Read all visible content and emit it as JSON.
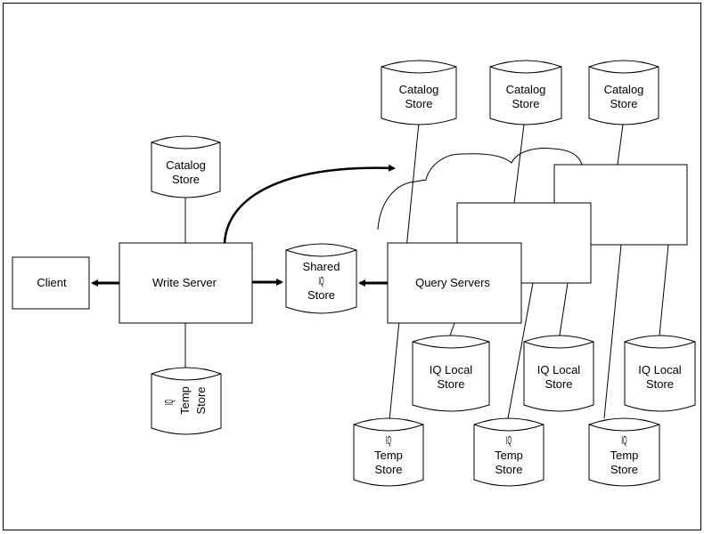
{
  "nodes": {
    "client": "Client",
    "write_server": "Write Server",
    "query_servers": "Query Servers",
    "write_catalog": [
      "Catalog",
      "Store"
    ],
    "write_temp": [
      "IQ",
      "Temp",
      "Store"
    ],
    "shared_store": [
      "Shared",
      "IQ",
      "Store"
    ],
    "query_catalogs": [
      [
        "Catalog",
        "Store"
      ],
      [
        "Catalog",
        "Store"
      ],
      [
        "Catalog",
        "Store"
      ]
    ],
    "local_stores": [
      [
        "IQ Local",
        "Store"
      ],
      [
        "IQ Local",
        "Store"
      ],
      [
        "IQ Local",
        "Store"
      ]
    ],
    "query_temps": [
      [
        "IQ",
        "Temp",
        "Store"
      ],
      [
        "IQ",
        "Temp",
        "Store"
      ],
      [
        "IQ",
        "Temp",
        "Store"
      ]
    ]
  }
}
